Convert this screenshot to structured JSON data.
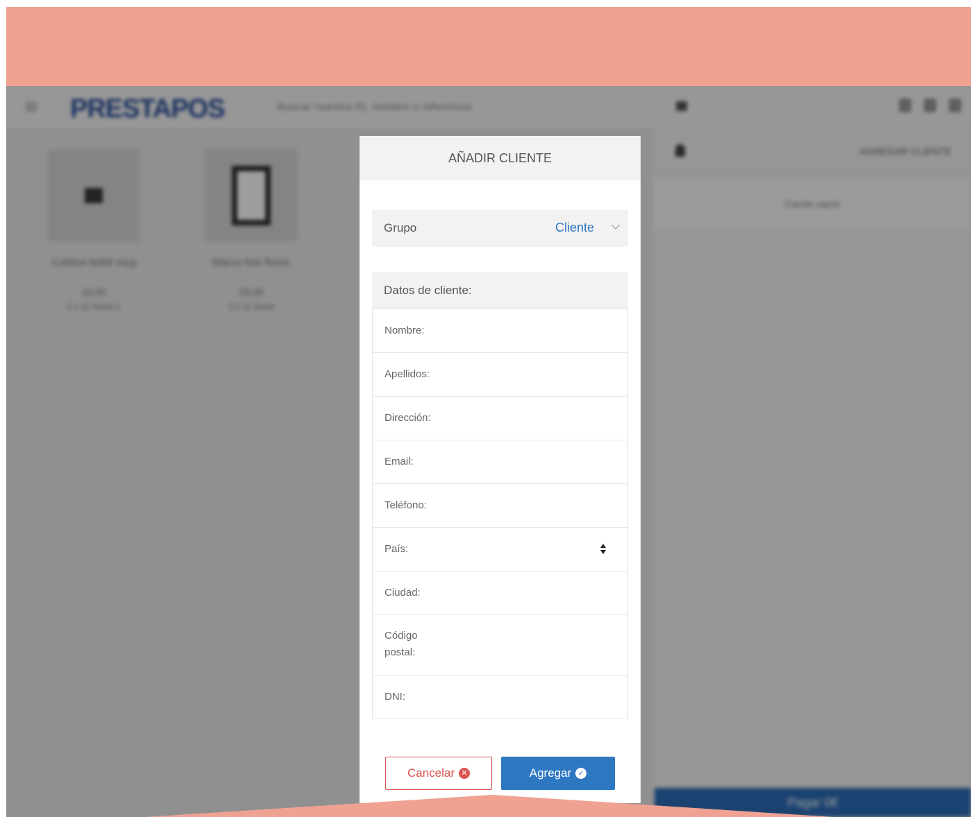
{
  "background_app": {
    "logo": "PRESTAPOS",
    "search_placeholder": "Buscar nuestra ID, nombre o referencia",
    "products": [
      {
        "name": "Cubitos bebé mug",
        "price": "10,00",
        "sub": "1 x 11 Stock 2"
      },
      {
        "name": "Marco foto flores",
        "price": "29,00",
        "sub": "1 x 11 Stock"
      }
    ],
    "customer_button": "AGREGAR CLIENTE",
    "cart_empty": "Carrito vacío",
    "pay_button": "Pagar 0€"
  },
  "modal": {
    "title": "AÑADIR CLIENTE",
    "group": {
      "label": "Grupo",
      "value": "Cliente"
    },
    "section_title": "Datos de cliente:",
    "fields": [
      {
        "label": "Nombre:"
      },
      {
        "label": "Apellidos:"
      },
      {
        "label": "Dirección:"
      },
      {
        "label": "Email:"
      },
      {
        "label": "Teléfono:"
      },
      {
        "label": "País:"
      },
      {
        "label": "Ciudad:"
      },
      {
        "label_line1": "Código",
        "label_line2": "postal:"
      },
      {
        "label": "DNI:"
      }
    ],
    "cancel_label": "Cancelar",
    "add_label": "Agregar"
  },
  "colors": {
    "accent_salmon": "#efa292",
    "primary_blue": "#2e78c2",
    "danger_red": "#d9534f"
  },
  "icons": [
    "chevron-down-icon",
    "sort-updown-icon",
    "close-circle-icon",
    "check-circle-icon"
  ]
}
